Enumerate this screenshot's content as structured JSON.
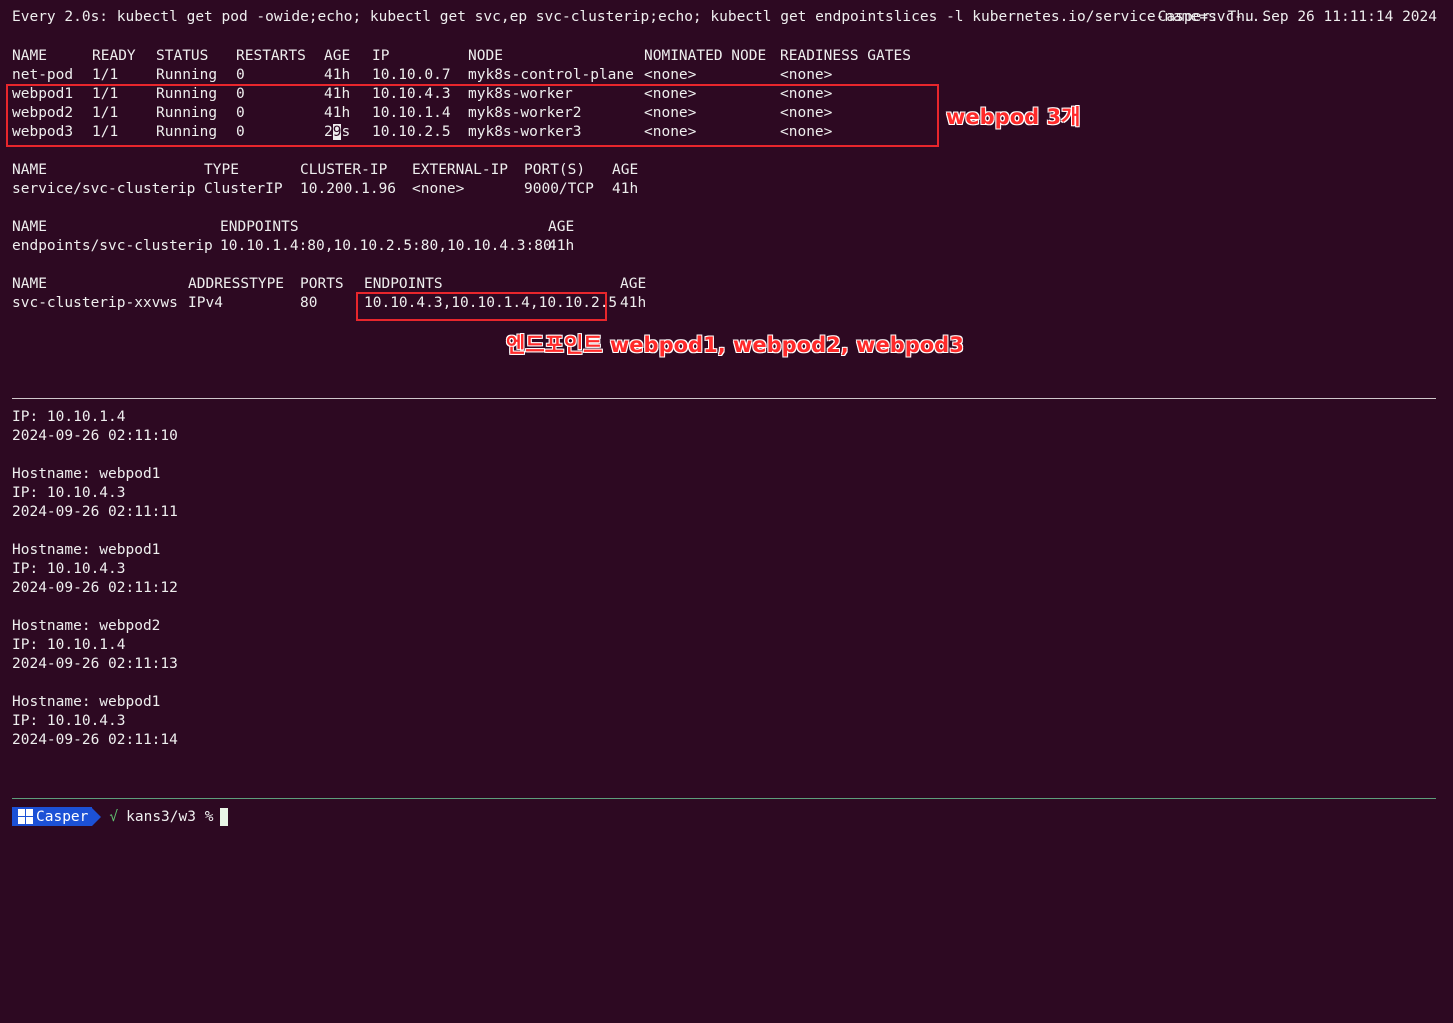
{
  "header": {
    "command": "Every 2.0s: kubectl get pod -owide;echo; kubectl get svc,ep svc-clusterip;echo; kubectl get endpointslices -l kubernetes.io/service-name=svc-...",
    "status": "Casper: Thu Sep 26 11:11:14 2024"
  },
  "pods": {
    "headers": [
      "NAME",
      "READY",
      "STATUS",
      "RESTARTS",
      "AGE",
      "IP",
      "NODE",
      "NOMINATED NODE",
      "READINESS GATES"
    ],
    "rows": [
      [
        "net-pod",
        "1/1",
        "Running",
        "0",
        "41h",
        "10.10.0.7",
        "myk8s-control-plane",
        "<none>",
        "<none>"
      ],
      [
        "webpod1",
        "1/1",
        "Running",
        "0",
        "41h",
        "10.10.4.3",
        "myk8s-worker",
        "<none>",
        "<none>"
      ],
      [
        "webpod2",
        "1/1",
        "Running",
        "0",
        "41h",
        "10.10.1.4",
        "myk8s-worker2",
        "<none>",
        "<none>"
      ],
      [
        "webpod3",
        "1/1",
        "Running",
        "0",
        "29s",
        "10.10.2.5",
        "myk8s-worker3",
        "<none>",
        "<none>"
      ]
    ]
  },
  "service": {
    "headers": [
      "NAME",
      "TYPE",
      "CLUSTER-IP",
      "EXTERNAL-IP",
      "PORT(S)",
      "AGE"
    ],
    "rows": [
      [
        "service/svc-clusterip",
        "ClusterIP",
        "10.200.1.96",
        "<none>",
        "9000/TCP",
        "41h"
      ]
    ]
  },
  "endpoints": {
    "headers": [
      "NAME",
      "ENDPOINTS",
      "AGE"
    ],
    "rows": [
      [
        "endpoints/svc-clusterip",
        "10.10.1.4:80,10.10.2.5:80,10.10.4.3:80",
        "41h"
      ]
    ]
  },
  "endpointslices": {
    "headers": [
      "NAME",
      "ADDRESSTYPE",
      "PORTS",
      "ENDPOINTS",
      "AGE"
    ],
    "rows": [
      [
        "svc-clusterip-xxvws",
        "IPv4",
        "80",
        "10.10.4.3,10.10.1.4,10.10.2.5",
        "41h"
      ]
    ]
  },
  "annotations": {
    "pods_note": "webpod 3개",
    "endpoints_note": "엔드포인트 webpod1, webpod2, webpod3"
  },
  "output": {
    "lines": [
      "IP: 10.10.1.4",
      "2024-09-26 02:11:10",
      "",
      "Hostname: webpod1",
      "IP: 10.10.4.3",
      "2024-09-26 02:11:11",
      "",
      "Hostname: webpod1",
      "IP: 10.10.4.3",
      "2024-09-26 02:11:12",
      "",
      "Hostname: webpod2",
      "IP: 10.10.1.4",
      "2024-09-26 02:11:13",
      "",
      "Hostname: webpod1",
      "IP: 10.10.4.3",
      "2024-09-26 02:11:14"
    ]
  },
  "prompt": {
    "user": "Casper",
    "check": "√",
    "path": "kans3/w3 %"
  },
  "colors": {
    "background": "#2d0922",
    "annotation": "#e8262c",
    "prompt_segment": "#1c51d6"
  }
}
